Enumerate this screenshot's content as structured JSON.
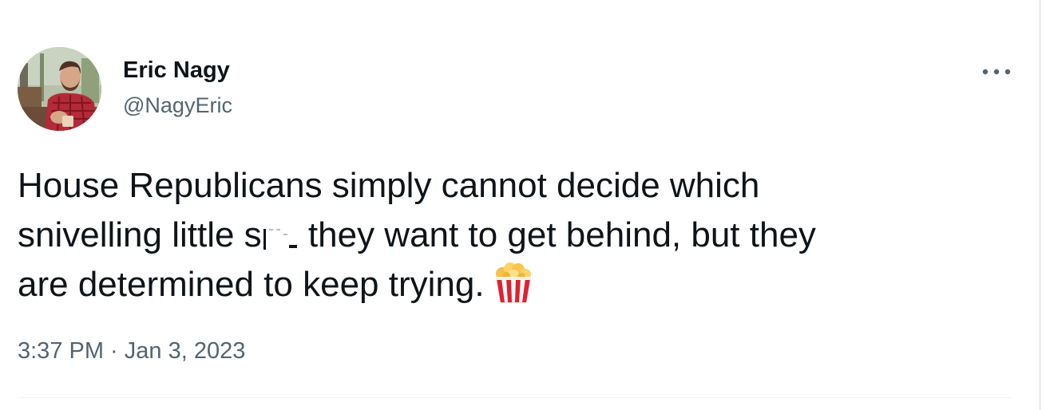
{
  "tweet": {
    "author": {
      "display_name": "Eric Nagy",
      "handle": "@NagyEric"
    },
    "text_lines": [
      "House Republicans simply cannot decide which",
      "snivelling little sh… they want to get behind, but they",
      "are determined to keep trying."
    ],
    "text_parts": {
      "line1": "House Republicans simply cannot decide which",
      "line2_before": "snivelling little s",
      "line2_after": " they want to get behind, but they",
      "line3": "are determined to keep trying."
    },
    "emoji": "popcorn-icon",
    "timestamp": "3:37 PM · Jan 3, 2023"
  },
  "colors": {
    "text_primary": "#0f1419",
    "text_secondary": "#536471",
    "divider": "#eff3f4",
    "popcorn_red": "#e2202e"
  }
}
